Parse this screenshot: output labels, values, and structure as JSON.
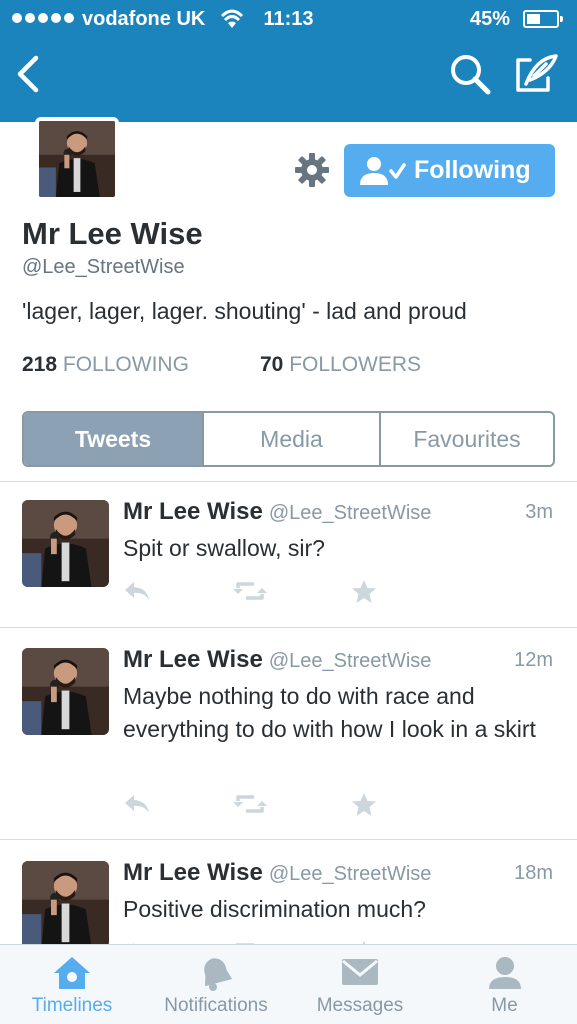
{
  "status_bar": {
    "carrier": "vodafone UK",
    "time": "11:13",
    "battery": "45%"
  },
  "nav": {
    "back_icon": "chevron-left-icon",
    "search_icon": "search-icon",
    "compose_icon": "compose-icon"
  },
  "profile": {
    "name": "Mr Lee Wise",
    "handle": "@Lee_StreetWise",
    "bio": "'lager, lager, lager. shouting' - lad and proud",
    "following_count": "218",
    "following_label": "FOLLOWING",
    "followers_count": "70",
    "followers_label": "FOLLOWERS",
    "follow_button_label": "Following"
  },
  "tabs": [
    {
      "label": "Tweets",
      "selected": true
    },
    {
      "label": "Media",
      "selected": false
    },
    {
      "label": "Favourites",
      "selected": false
    }
  ],
  "tweets": [
    {
      "name": "Mr Lee Wise",
      "handle": "@Lee_StreetWise",
      "time": "3m",
      "text": "Spit or swallow, sir?"
    },
    {
      "name": "Mr Lee Wise",
      "handle": "@Lee_StreetWise",
      "time": "12m",
      "text": "Maybe nothing to do with race and everything to do with how I look in a skirt"
    },
    {
      "name": "Mr Lee Wise",
      "handle": "@Lee_StreetWise",
      "time": "18m",
      "text": "Positive discrimination much?"
    }
  ],
  "tab_bar": [
    {
      "label": "Timelines",
      "icon": "home-icon",
      "active": true
    },
    {
      "label": "Notifications",
      "icon": "bell-icon",
      "active": false
    },
    {
      "label": "Messages",
      "icon": "envelope-icon",
      "active": false
    },
    {
      "label": "Me",
      "icon": "person-icon",
      "active": false
    }
  ],
  "colors": {
    "header": "#1b84bd",
    "accent": "#55acee",
    "muted": "#8899a6",
    "text": "#292f33"
  }
}
